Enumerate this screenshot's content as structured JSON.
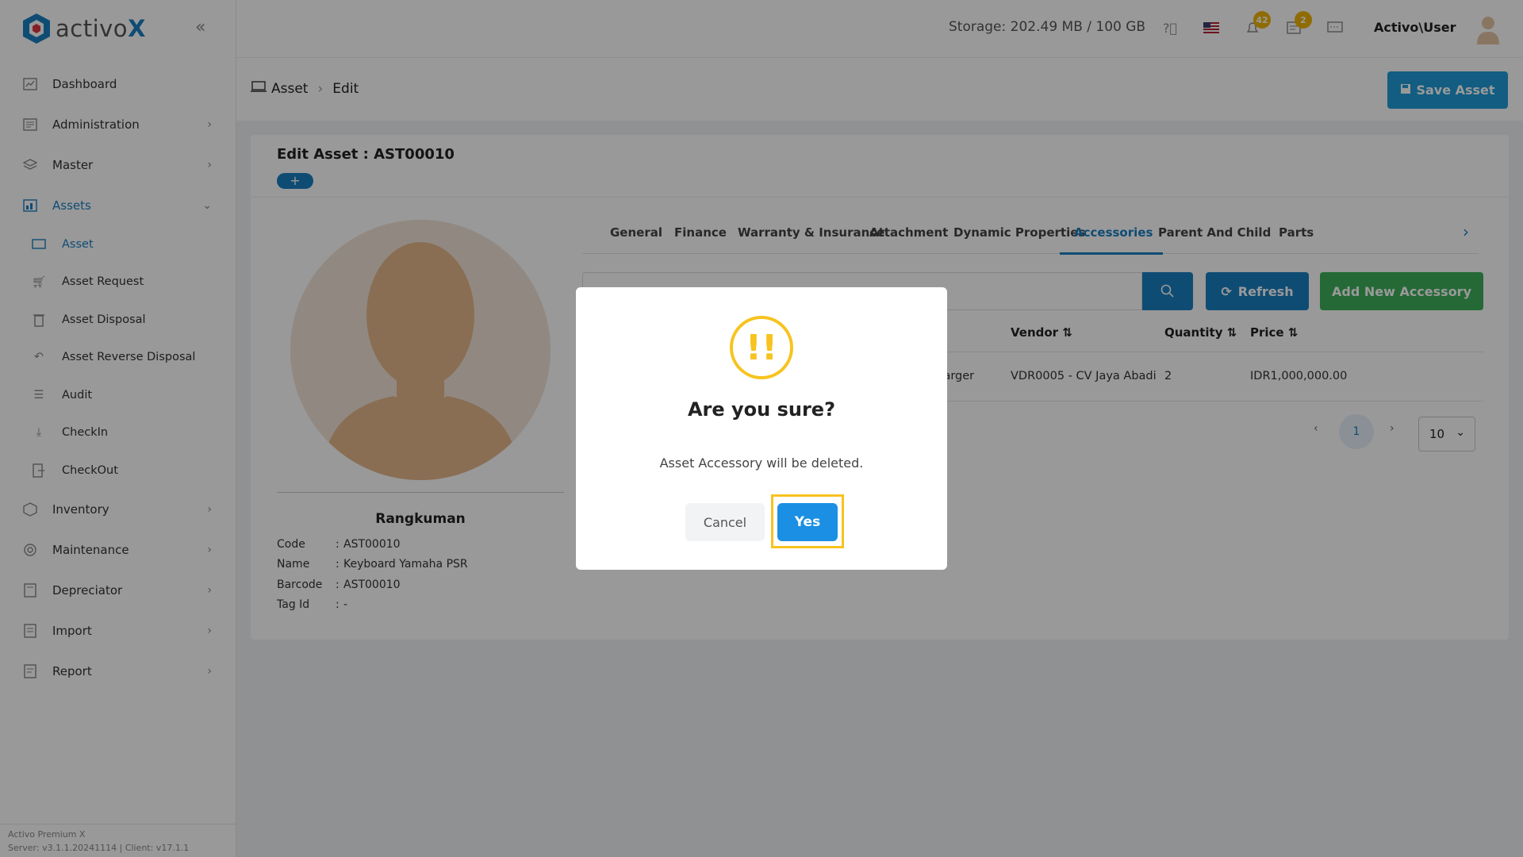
{
  "brand": {
    "name_prefix": "activo",
    "name_suffix": "X"
  },
  "sidebar": {
    "items": [
      {
        "label": "Dashboard"
      },
      {
        "label": "Administration"
      },
      {
        "label": "Master"
      },
      {
        "label": "Assets"
      },
      {
        "label": "Inventory"
      },
      {
        "label": "Maintenance"
      },
      {
        "label": "Depreciator"
      },
      {
        "label": "Import"
      },
      {
        "label": "Report"
      }
    ],
    "asset_subitems": [
      {
        "label": "Asset"
      },
      {
        "label": "Asset Request"
      },
      {
        "label": "Asset Disposal"
      },
      {
        "label": "Asset Reverse Disposal"
      },
      {
        "label": "Audit"
      },
      {
        "label": "CheckIn"
      },
      {
        "label": "CheckOut"
      }
    ],
    "footer_line1": "Activo Premium X",
    "footer_line2": "Server: v3.1.1.20241114 | Client: v17.1.1"
  },
  "topbar": {
    "storage": "Storage: 202.49 MB / 100 GB",
    "notif_badge_1": "42",
    "notif_badge_2": "2",
    "user": "Activo\\User"
  },
  "breadcrumb": {
    "root": "Asset",
    "current": "Edit"
  },
  "save_button": "Save Asset",
  "card": {
    "title": "Edit Asset : AST00010",
    "plus": "+",
    "summary_title": "Rangkuman",
    "summary": [
      {
        "k": "Code",
        "v": "AST00010"
      },
      {
        "k": "Name",
        "v": "Keyboard Yamaha PSR"
      },
      {
        "k": "Barcode",
        "v": "AST00010"
      },
      {
        "k": "Tag Id",
        "v": "-"
      }
    ]
  },
  "tabs": [
    {
      "label": "General"
    },
    {
      "label": "Finance"
    },
    {
      "label": "Warranty & Insurance"
    },
    {
      "label": "Attachment"
    },
    {
      "label": "Dynamic Properties"
    },
    {
      "label": "Accessories"
    },
    {
      "label": "Parent And Child"
    },
    {
      "label": "Parts"
    }
  ],
  "toolbar": {
    "search_placeholder": "Search",
    "refresh": "Refresh",
    "add_new": "Add New Accessory"
  },
  "table": {
    "headers": {
      "vendor": "Vendor",
      "quantity": "Quantity",
      "price": "Price"
    },
    "row": {
      "name": "Adapter Charger",
      "vendor": "VDR0005 - CV Jaya Abadi",
      "quantity": "2",
      "price": "IDR1,000,000.00"
    }
  },
  "pagination": {
    "page": "1",
    "page_size": "10"
  },
  "modal": {
    "icon_text": "!!",
    "title": "Are you sure?",
    "text": "Asset Accessory will be deleted.",
    "cancel": "Cancel",
    "confirm": "Yes"
  },
  "colors": {
    "primary": "#1a7fc1",
    "success": "#3cb05a",
    "warning": "#f7c31e"
  }
}
